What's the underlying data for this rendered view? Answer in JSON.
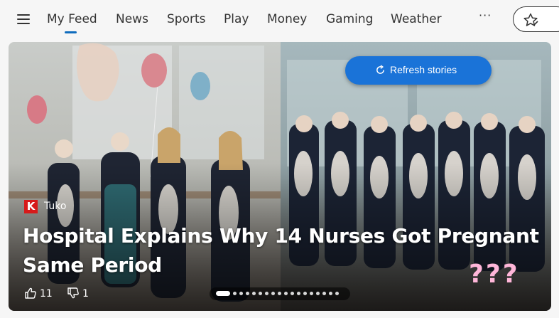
{
  "nav": {
    "items": [
      {
        "label": "My Feed",
        "active": true
      },
      {
        "label": "News"
      },
      {
        "label": "Sports"
      },
      {
        "label": "Play"
      },
      {
        "label": "Money"
      },
      {
        "label": "Gaming"
      },
      {
        "label": "Weather"
      }
    ],
    "more_label": "···",
    "icons": {
      "menu": "hamburger-icon",
      "personalize": "star-edit-icon"
    }
  },
  "hero": {
    "refresh_label": "Refresh stories",
    "source": {
      "logo_letter": "K",
      "name": "Tuko",
      "logo_color": "#d71a1a"
    },
    "headline": "Hospital Explains Why 14 Nurses Got Pregnant Same Period",
    "reactions": {
      "likes": "11",
      "dislikes": "1"
    },
    "overlay_text": "???",
    "carousel": {
      "total": 18,
      "current": 1
    }
  },
  "colors": {
    "accent": "#0f6cbd",
    "refresh_button": "#1a73d8",
    "overlay_text": "#ffb6d9"
  }
}
